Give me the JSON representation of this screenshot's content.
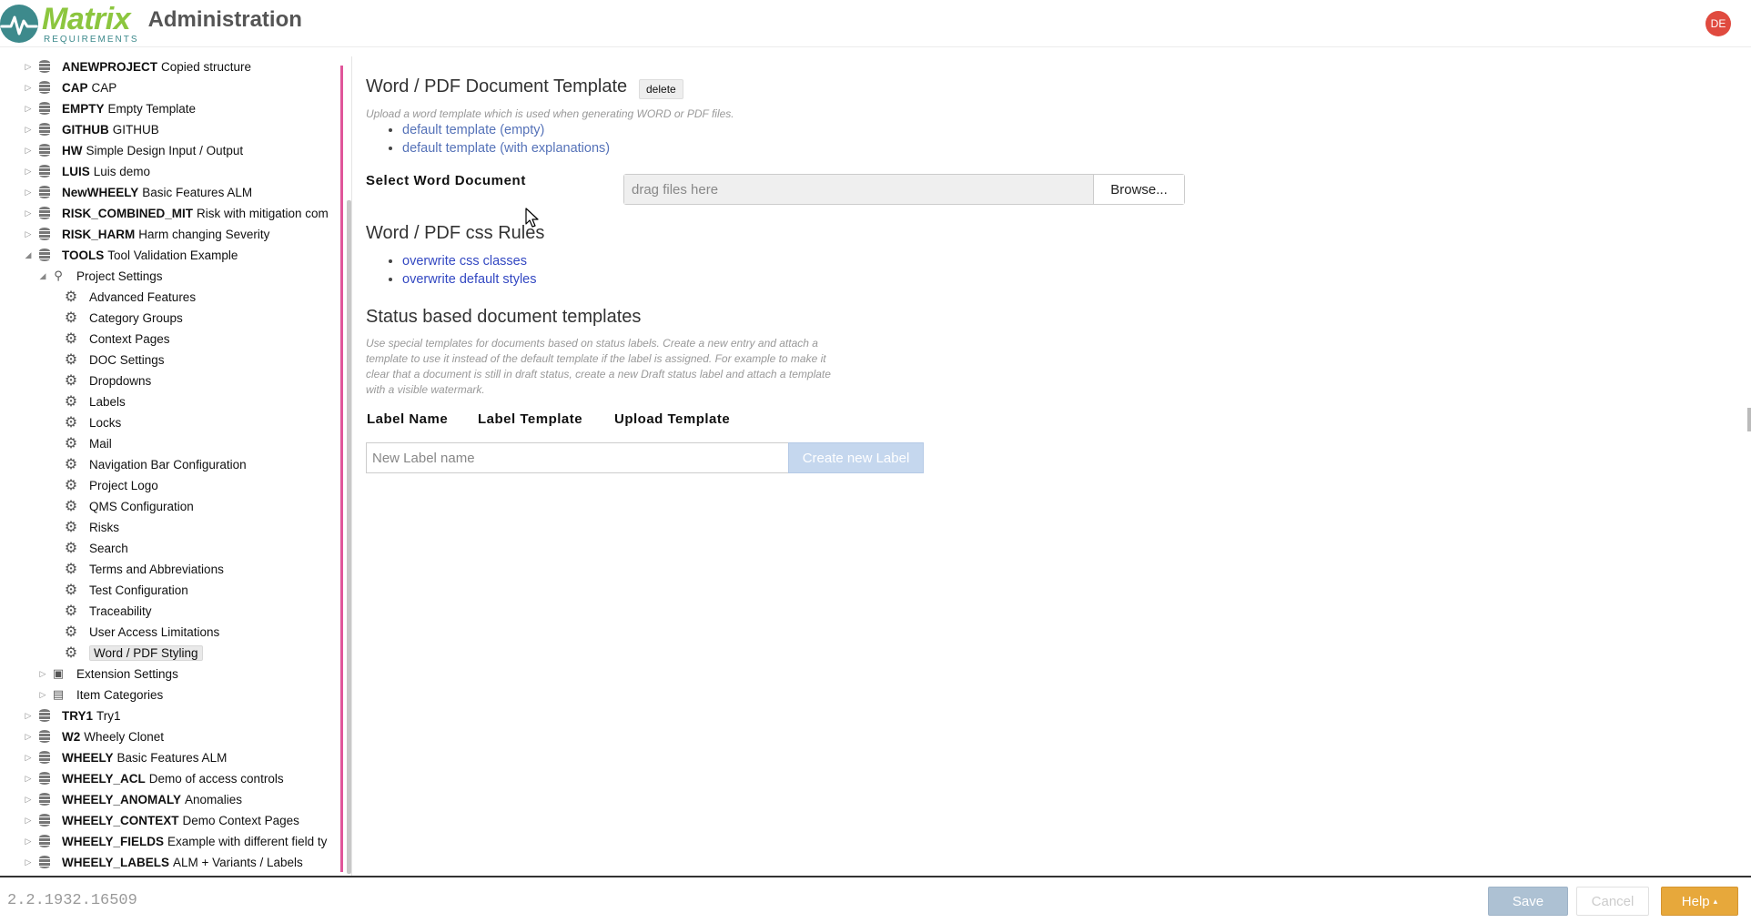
{
  "header": {
    "logo_name": "Matrix",
    "logo_sub": "REQUIREMENTS",
    "app_title": "Administration",
    "avatar_initials": "DE",
    "colors": {
      "logo_green": "#8cc63f",
      "logo_teal": "#3d8a8c",
      "avatar": "#e04a3f"
    }
  },
  "tree": {
    "projects_top": [
      {
        "key": "ANEWPROJECT",
        "name": "Copied structure"
      },
      {
        "key": "CAP",
        "name": "CAP"
      },
      {
        "key": "EMPTY",
        "name": "Empty Template"
      },
      {
        "key": "GITHUB",
        "name": "GITHUB"
      },
      {
        "key": "HW",
        "name": "Simple Design Input / Output"
      },
      {
        "key": "LUIS",
        "name": "Luis demo"
      },
      {
        "key": "NewWHEELY",
        "name": "Basic Features ALM"
      },
      {
        "key": "RISK_COMBINED_MIT",
        "name": "Risk with mitigation com"
      },
      {
        "key": "RISK_HARM",
        "name": "Harm changing Severity"
      },
      {
        "key": "TOOLS",
        "name": "Tool Validation Example"
      }
    ],
    "project_settings_label": "Project Settings",
    "settings": [
      "Advanced Features",
      "Category Groups",
      "Context Pages",
      "DOC Settings",
      "Dropdowns",
      "Labels",
      "Locks",
      "Mail",
      "Navigation Bar Configuration",
      "Project Logo",
      "QMS Configuration",
      "Risks",
      "Search",
      "Terms and Abbreviations",
      "Test Configuration",
      "Traceability",
      "User Access Limitations",
      "Word / PDF Styling"
    ],
    "extension_settings_label": "Extension Settings",
    "item_categories_label": "Item Categories",
    "projects_bottom": [
      {
        "key": "TRY1",
        "name": "Try1"
      },
      {
        "key": "W2",
        "name": "Wheely Clonet"
      },
      {
        "key": "WHEELY",
        "name": "Basic Features ALM"
      },
      {
        "key": "WHEELY_ACL",
        "name": "Demo of access controls"
      },
      {
        "key": "WHEELY_ANOMALY",
        "name": "Anomalies"
      },
      {
        "key": "WHEELY_CONTEXT",
        "name": "Demo Context Pages"
      },
      {
        "key": "WHEELY_FIELDS",
        "name": "Example with different field ty"
      },
      {
        "key": "WHEELY_LABELS",
        "name": "ALM + Variants / Labels"
      }
    ]
  },
  "main": {
    "template_title": "Word / PDF Document Template",
    "delete_label": "delete",
    "template_hint": "Upload a word template which is used when generating WORD or PDF files.",
    "template_links": [
      "default template (empty)",
      "default template (with explanations)"
    ],
    "select_word_label": "Select Word Document",
    "drop_placeholder": "drag files here",
    "browse_label": "Browse...",
    "css_title": "Word / PDF css Rules",
    "css_links": [
      "overwrite css classes",
      "overwrite default styles"
    ],
    "status_title": "Status based document templates",
    "status_hint_lines": [
      "Use special templates for documents based on status labels. Create a new entry and attach a",
      "template to use it instead of the default template if the label is assigned. For example to make it",
      "clear that a document is still in draft status, create a new Draft status label and attach a template",
      "with a visible watermark."
    ],
    "col_label_name": "Label Name",
    "col_label_template": "Label Template",
    "col_upload_template": "Upload Template",
    "new_label_placeholder": "New Label name",
    "create_label_button": "Create new Label"
  },
  "footer": {
    "version": "2.2.1932.16509",
    "save_label": "Save",
    "cancel_label": "Cancel",
    "help_label": "Help",
    "help_caret": "▴"
  }
}
